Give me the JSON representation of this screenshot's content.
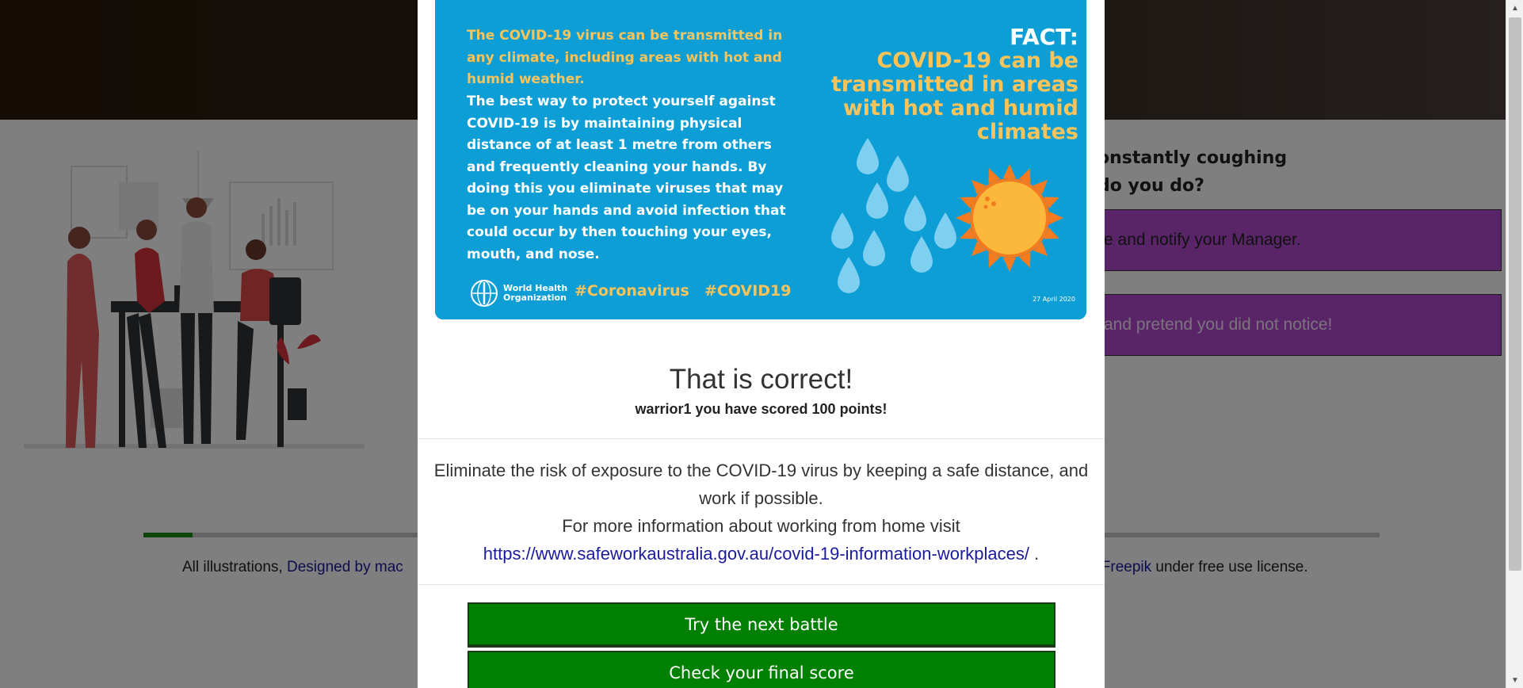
{
  "background": {
    "question_lines": [
      "onstantly coughing",
      "do you do?"
    ],
    "answers": [
      "e and notify your Manager.",
      " and pretend you did not notice!"
    ],
    "progress": 0.04,
    "footer": {
      "prefix": "All illustrations, ",
      "link_left": "Designed by mac",
      "link_right": "y Freepik",
      "suffix": " under free use license."
    }
  },
  "modal": {
    "fact_card": {
      "lead": "The COVID-19 virus can be transmitted in any climate, including areas with hot and humid weather.",
      "body": "The best way to protect yourself against COVID-19 is by maintaining physical distance of at least 1 metre from others and frequently cleaning your hands. By doing this you eliminate viruses that may be on your hands and avoid infection that could occur by then touching your eyes, mouth, and nose.",
      "label": "FACT:",
      "headline": "COVID-19 can be transmitted in areas with hot and humid climates",
      "org_line1": "World Health",
      "org_line2": "Organization",
      "hashtag1": "#Coronavirus",
      "hashtag2": "#COVID19",
      "date": "27 April 2020"
    },
    "result_title": "That is correct!",
    "result_sub": "warrior1 you have scored 100 points!",
    "info_line1": "Eliminate the risk of exposure to the COVID-19 virus by keeping a safe distance, and work if possible.",
    "info_line2": "For more information about working from home visit",
    "info_link": "https://www.safeworkaustralia.gov.au/covid-19-information-workplaces/",
    "info_link_suffix": " .",
    "next_button": "Try the next battle",
    "score_button": "Check your final score"
  },
  "colors": {
    "accent_green": "#008000",
    "answer_purple": "#b44ad0",
    "fact_blue": "#0d9ed5",
    "fact_yellow": "#fbc45a",
    "link_blue": "#1b1b9b"
  },
  "icons": [
    "who-logo-icon",
    "water-droplets-icon",
    "sun-icon",
    "scroll-up-arrow-icon",
    "scroll-down-arrow-icon"
  ]
}
